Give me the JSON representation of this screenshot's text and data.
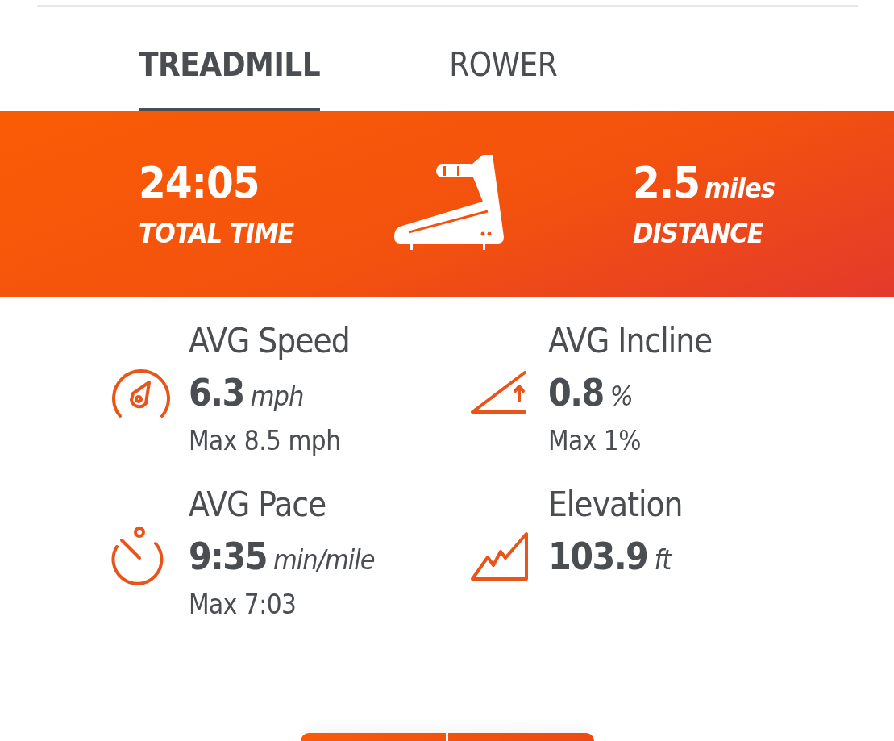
{
  "tabs": [
    {
      "label": "TREADMILL",
      "selected": true
    },
    {
      "label": "ROWER",
      "selected": false
    }
  ],
  "summary": {
    "total_time": {
      "value": "24:05",
      "label": "TOTAL TIME"
    },
    "distance": {
      "value": "2.5",
      "unit": "miles",
      "label": "DISTANCE"
    }
  },
  "stats": [
    {
      "kind": "speed",
      "title": "AVG Speed",
      "value": "6.3",
      "unit": "mph",
      "max": "Max 8.5 mph"
    },
    {
      "kind": "incline",
      "title": "AVG Incline",
      "value": "0.8",
      "unit": "%",
      "max": "Max 1%"
    },
    {
      "kind": "pace",
      "title": "AVG Pace",
      "value": "9:35",
      "unit": "min/mile",
      "max": "Max 7:03"
    },
    {
      "kind": "elevation",
      "title": "Elevation",
      "value": "103.9",
      "unit": "ft"
    }
  ]
}
